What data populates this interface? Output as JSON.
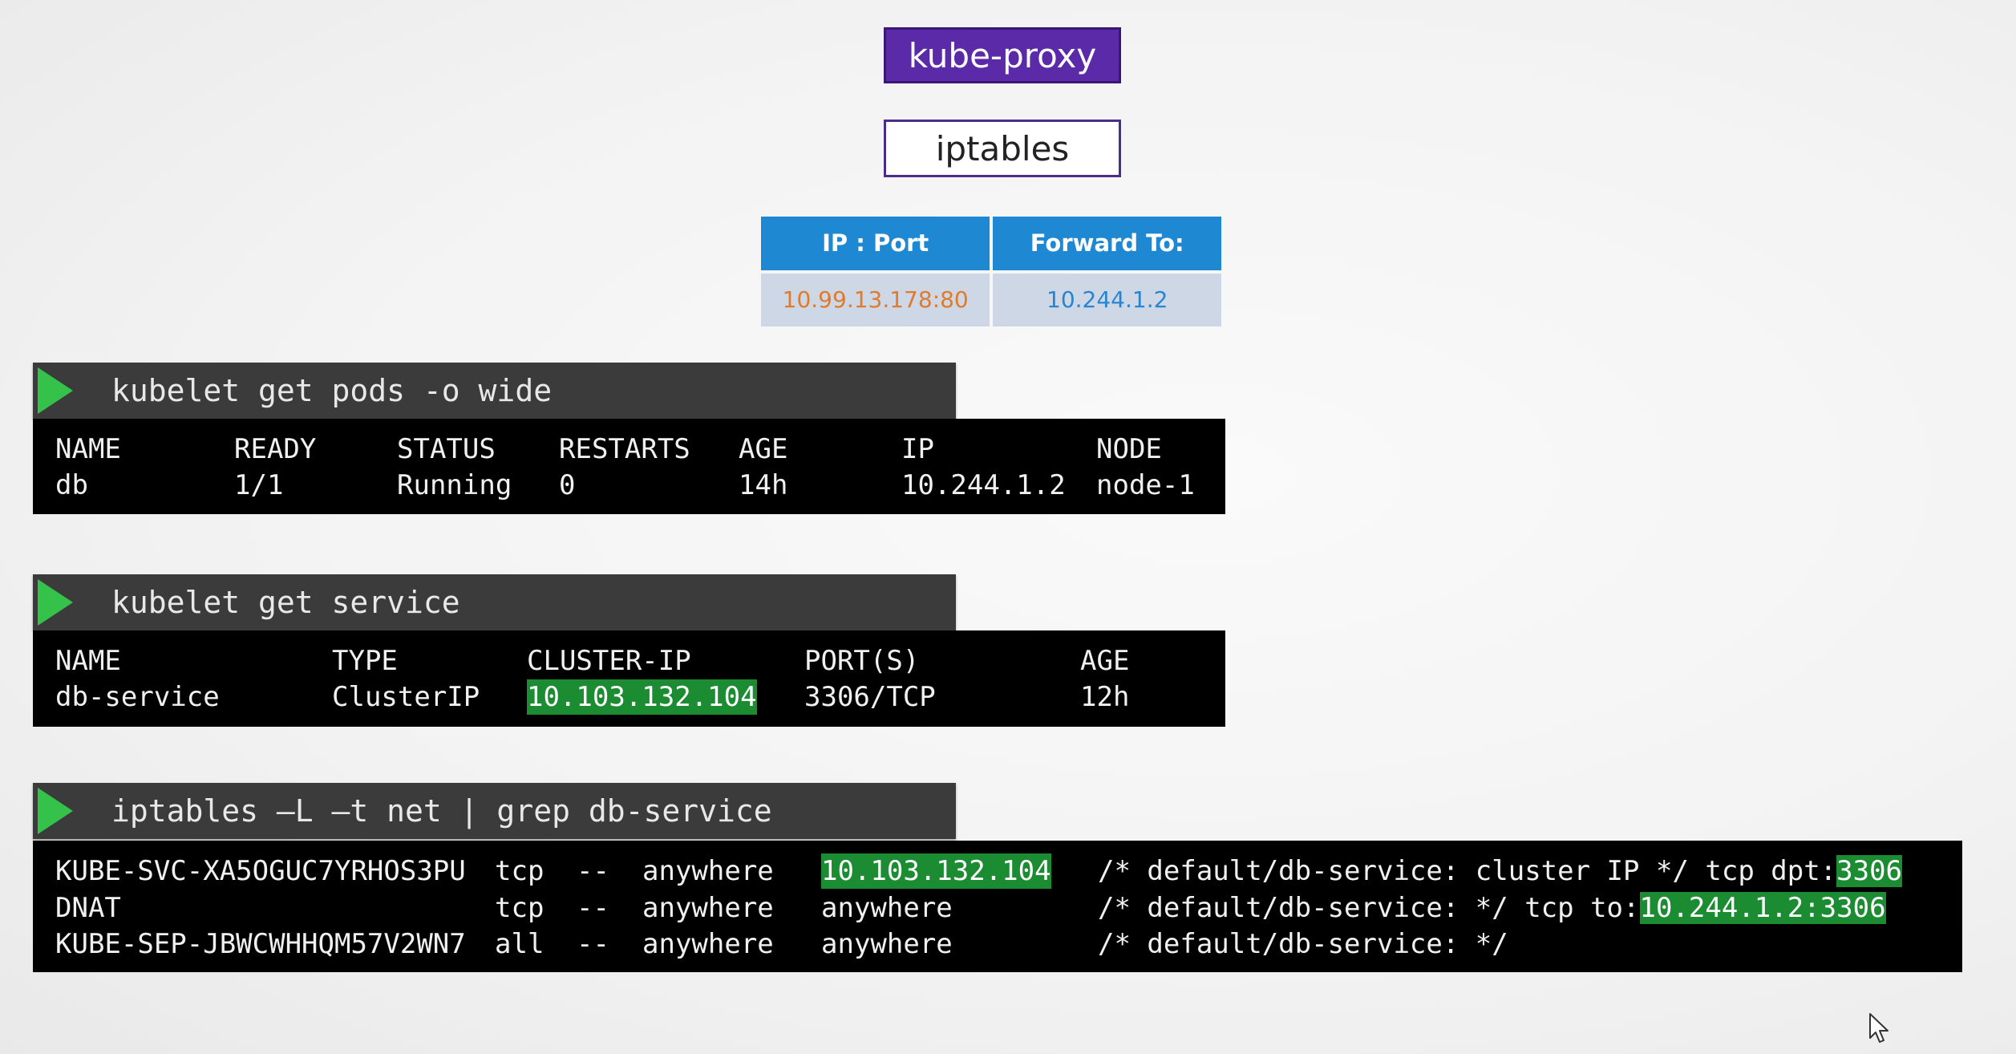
{
  "header": {
    "kube_proxy": "kube-proxy",
    "iptables": "iptables"
  },
  "forward_table": {
    "headers": [
      "IP : Port",
      "Forward To:"
    ],
    "row": [
      "10.99.13.178:80",
      "10.244.1.2"
    ]
  },
  "pods": {
    "command": "kubelet get pods -o wide",
    "columns": [
      "NAME",
      "READY",
      "STATUS",
      "RESTARTS",
      "AGE",
      "IP",
      "NODE"
    ],
    "row": [
      "db",
      "1/1",
      "Running",
      "0",
      "14h",
      "10.244.1.2",
      "node-1"
    ]
  },
  "service": {
    "command": "kubelet get service",
    "columns": [
      "NAME",
      "TYPE",
      "CLUSTER-IP",
      "PORT(S)",
      "AGE"
    ],
    "row": [
      "db-service",
      "ClusterIP",
      "10.103.132.104",
      "3306/TCP",
      "12h"
    ]
  },
  "iptables_out": {
    "command": "iptables –L –t net | grep db-service",
    "rows": [
      {
        "chain": "KUBE-SVC-XA5OGUC7YRHOS3PU",
        "prot": "tcp",
        "opt": "--",
        "src": "anywhere",
        "dst": "10.103.132.104",
        "comment_prefix": "/* default/db-service: cluster IP */ tcp dpt:",
        "comment_hl": "3306"
      },
      {
        "chain": "DNAT",
        "prot": "tcp",
        "opt": "--",
        "src": "anywhere",
        "dst": "anywhere",
        "comment_prefix": "/* default/db-service: */ tcp to:",
        "comment_hl": "10.244.1.2:3306"
      },
      {
        "chain": "KUBE-SEP-JBWCWHHQM57V2WN7",
        "prot": "all",
        "opt": "--",
        "src": "anywhere",
        "dst": "anywhere",
        "comment_prefix": "/* default/db-service: */",
        "comment_hl": ""
      }
    ]
  },
  "colors": {
    "kube_proxy_bg": "#5b2aa8",
    "table_header": "#1e88d3",
    "table_cell": "#cdd7e6",
    "ip_text": "#e07b2a",
    "forward_text": "#2a85cf",
    "highlight": "#1c8c32",
    "play": "#35c24a"
  }
}
